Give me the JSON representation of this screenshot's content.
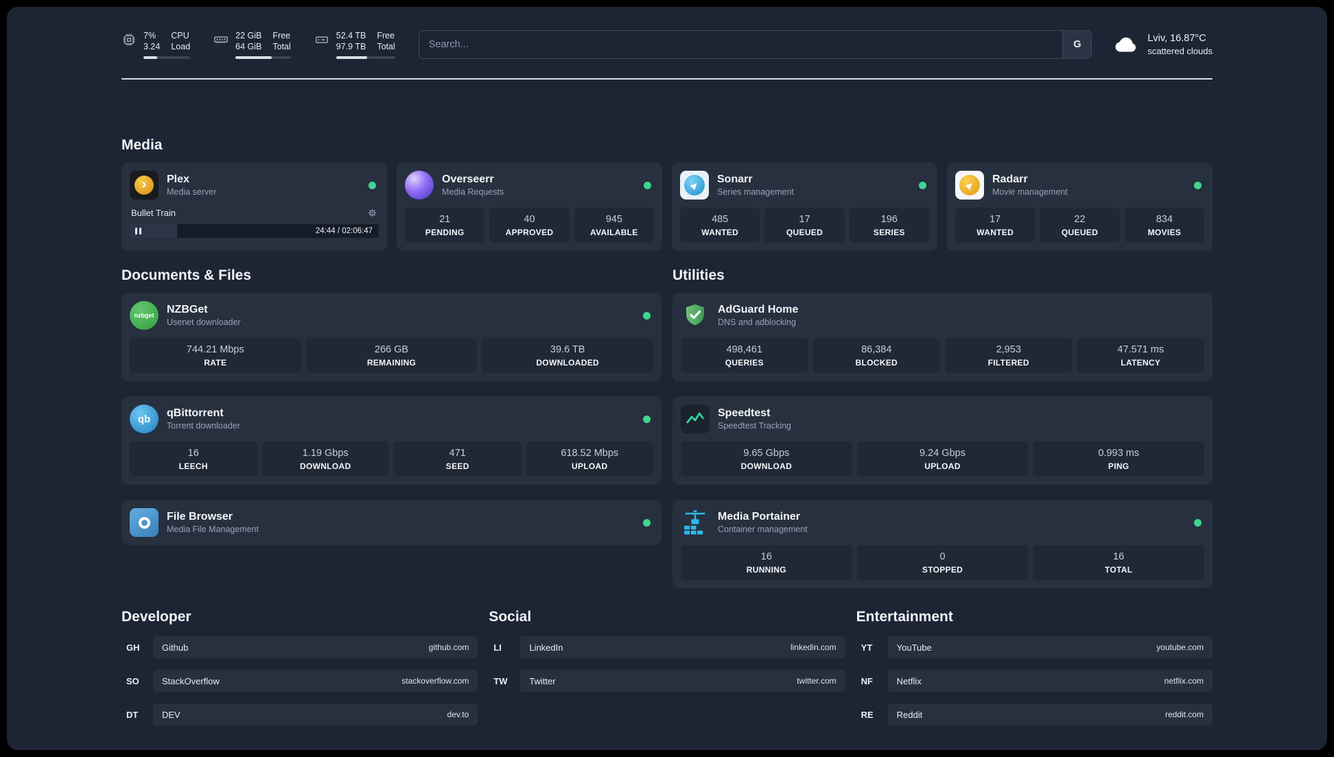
{
  "topbar": {
    "cpu": {
      "value_top": "7%",
      "value_bottom": "3.24",
      "label_top": "CPU",
      "label_bottom": "Load",
      "percent": 30
    },
    "ram": {
      "value_top": "22 GiB",
      "value_bottom": "64 GiB",
      "label_top": "Free",
      "label_bottom": "Total",
      "percent": 66
    },
    "disk": {
      "value_top": "52.4 TB",
      "value_bottom": "97.9 TB",
      "label_top": "Free",
      "label_bottom": "Total",
      "percent": 53
    },
    "search": {
      "placeholder": "Search...",
      "button": "G"
    },
    "weather": {
      "location": "Lviv, 16.87°C",
      "condition": "scattered clouds"
    }
  },
  "sections": {
    "media": {
      "title": "Media",
      "plex": {
        "name": "Plex",
        "desc": "Media server",
        "track": "Bullet Train",
        "time": "24:44 / 02:06:47",
        "progress": 19
      },
      "overseerr": {
        "name": "Overseerr",
        "desc": "Media Requests",
        "stats": [
          {
            "value": "21",
            "label": "PENDING"
          },
          {
            "value": "40",
            "label": "APPROVED"
          },
          {
            "value": "945",
            "label": "AVAILABLE"
          }
        ]
      },
      "sonarr": {
        "name": "Sonarr",
        "desc": "Series management",
        "stats": [
          {
            "value": "485",
            "label": "WANTED"
          },
          {
            "value": "17",
            "label": "QUEUED"
          },
          {
            "value": "196",
            "label": "SERIES"
          }
        ]
      },
      "radarr": {
        "name": "Radarr",
        "desc": "Movie management",
        "stats": [
          {
            "value": "17",
            "label": "WANTED"
          },
          {
            "value": "22",
            "label": "QUEUED"
          },
          {
            "value": "834",
            "label": "MOVIES"
          }
        ]
      }
    },
    "documents": {
      "title": "Documents & Files",
      "nzbget": {
        "name": "NZBGet",
        "desc": "Usenet downloader",
        "stats": [
          {
            "value": "744.21 Mbps",
            "label": "RATE"
          },
          {
            "value": "266 GB",
            "label": "REMAINING"
          },
          {
            "value": "39.6 TB",
            "label": "DOWNLOADED"
          }
        ]
      },
      "qbittorrent": {
        "name": "qBittorrent",
        "desc": "Torrent downloader",
        "stats": [
          {
            "value": "16",
            "label": "LEECH"
          },
          {
            "value": "1.19 Gbps",
            "label": "DOWNLOAD"
          },
          {
            "value": "471",
            "label": "SEED"
          },
          {
            "value": "618.52 Mbps",
            "label": "UPLOAD"
          }
        ]
      },
      "filebrowser": {
        "name": "File Browser",
        "desc": "Media File Management"
      }
    },
    "utilities": {
      "title": "Utilities",
      "adguard": {
        "name": "AdGuard Home",
        "desc": "DNS and adblocking",
        "stats": [
          {
            "value": "498,461",
            "label": "QUERIES"
          },
          {
            "value": "86,384",
            "label": "BLOCKED"
          },
          {
            "value": "2,953",
            "label": "FILTERED"
          },
          {
            "value": "47.571 ms",
            "label": "LATENCY"
          }
        ]
      },
      "speedtest": {
        "name": "Speedtest",
        "desc": "Speedtest Tracking",
        "stats": [
          {
            "value": "9.65 Gbps",
            "label": "DOWNLOAD"
          },
          {
            "value": "9.24 Gbps",
            "label": "UPLOAD"
          },
          {
            "value": "0.993 ms",
            "label": "PING"
          }
        ]
      },
      "portainer": {
        "name": "Media Portainer",
        "desc": "Container management",
        "stats": [
          {
            "value": "16",
            "label": "RUNNING"
          },
          {
            "value": "0",
            "label": "STOPPED"
          },
          {
            "value": "16",
            "label": "TOTAL"
          }
        ]
      }
    },
    "bookmarks": {
      "developer": {
        "title": "Developer",
        "items": [
          {
            "abbr": "GH",
            "name": "Github",
            "url": "github.com"
          },
          {
            "abbr": "SO",
            "name": "StackOverflow",
            "url": "stackoverflow.com"
          },
          {
            "abbr": "DT",
            "name": "DEV",
            "url": "dev.to"
          }
        ]
      },
      "social": {
        "title": "Social",
        "items": [
          {
            "abbr": "LI",
            "name": "LinkedIn",
            "url": "linkedin.com"
          },
          {
            "abbr": "TW",
            "name": "Twitter",
            "url": "twitter.com"
          }
        ]
      },
      "entertainment": {
        "title": "Entertainment",
        "items": [
          {
            "abbr": "YT",
            "name": "YouTube",
            "url": "youtube.com"
          },
          {
            "abbr": "NF",
            "name": "Netflix",
            "url": "netflix.com"
          },
          {
            "abbr": "RE",
            "name": "Reddit",
            "url": "reddit.com"
          }
        ]
      }
    }
  },
  "icons": {
    "plex_glyph": "›",
    "sonarr_glyph": "▶",
    "radarr_glyph": "▶",
    "qbittorrent_glyph": "qb",
    "nzbget_glyph": "nzbget"
  },
  "colors": {
    "background": "#1d2534",
    "card": "#27303f",
    "stat_box": "#202836",
    "status_online": "#3fd68f",
    "divider": "#d9dee5",
    "plex_amber": "#e5a00d",
    "adguard_green": "#57ab63",
    "speedtest_green": "#2fd6a0",
    "portainer_blue": "#2fb9ed"
  }
}
